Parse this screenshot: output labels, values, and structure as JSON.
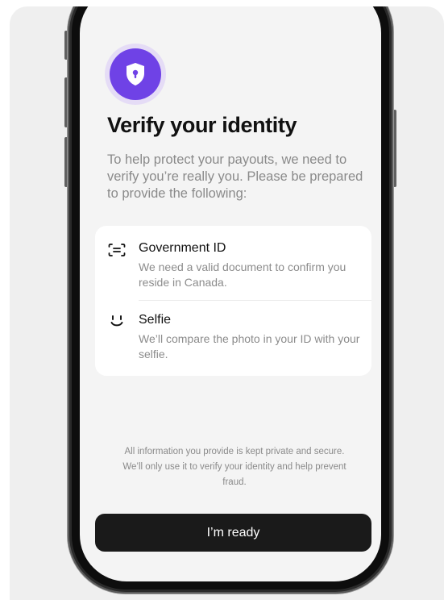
{
  "identity": {
    "title": "Verify your identity",
    "subtitle": "To help protect your payouts, we need to verify you’re really you. Please be prepared to provide the following:"
  },
  "requirements": [
    {
      "icon": "id-card-icon",
      "title": "Government ID",
      "description": "We need a valid document to confirm you reside in Canada."
    },
    {
      "icon": "face-icon",
      "title": "Selfie",
      "description": "We’ll compare the photo in your ID with your selfie."
    }
  ],
  "footer": {
    "privacy_note": "All information you provide is kept private and secure. We’ll only use it to verify your identity and help prevent fraud.",
    "cta_label": "I’m ready"
  },
  "colors": {
    "accent": "#6f42e6",
    "accent_soft": "#e5dcf6",
    "button": "#1a1a1a",
    "screen_bg": "#f4f4f4"
  }
}
